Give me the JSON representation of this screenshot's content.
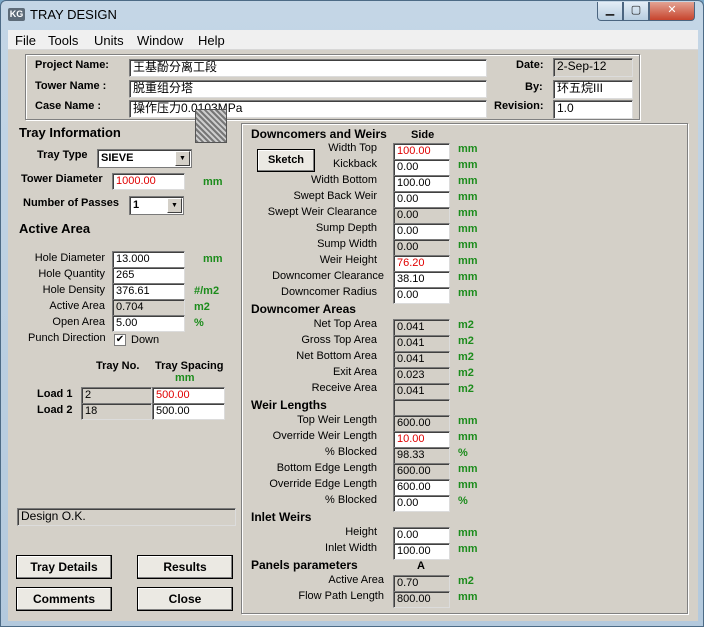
{
  "window": {
    "title": "TRAY DESIGN",
    "icon_text": "KG",
    "min_glyph": "▁",
    "max_glyph": "▢",
    "close_glyph": "✕"
  },
  "menu": [
    "File",
    "Tools",
    "Units",
    "Window",
    "Help"
  ],
  "header": {
    "project_label": "Project Name:",
    "project_value": "王基酚分离工段",
    "tower_label": "Tower Name :",
    "tower_value": "脱重组分塔",
    "case_label": "Case Name :",
    "case_value": "操作压力0.0103MPa",
    "date_label": "Date:",
    "date_value": "2-Sep-12",
    "by_label": "By:",
    "by_value": "环五烷III",
    "revision_label": "Revision:",
    "revision_value": "1.0"
  },
  "tray_info": {
    "heading": "Tray Information",
    "type_label": "Tray Type",
    "type_value": "SIEVE",
    "diameter_label": "Tower Diameter",
    "diameter_value": "1000.00",
    "diameter_unit": "mm",
    "passes_label": "Number of Passes",
    "passes_value": "1"
  },
  "active_area": {
    "heading": "Active Area",
    "rows": [
      {
        "label": "Hole Diameter",
        "value": "13.000",
        "unit": "mm",
        "readonly": false
      },
      {
        "label": "Hole Quantity",
        "value": "265",
        "unit": "",
        "readonly": false
      },
      {
        "label": "Hole Density",
        "value": "376.61",
        "unit": "#/m2",
        "readonly": false
      },
      {
        "label": "Active Area",
        "value": "0.704",
        "unit": "m2",
        "readonly": true
      },
      {
        "label": "Open Area",
        "value": "5.00",
        "unit": "%",
        "readonly": false
      }
    ],
    "punch_label": "Punch Direction",
    "punch_checked": "✔",
    "punch_value": "Down"
  },
  "loads": {
    "tray_no_header": "Tray No.",
    "spacing_header": "Tray Spacing",
    "spacing_unit": "mm",
    "rows": [
      {
        "label": "Load 1",
        "tray_no": "2",
        "spacing": "500.00"
      },
      {
        "label": "Load 2",
        "tray_no": "18",
        "spacing": "500.00"
      }
    ]
  },
  "status": "Design O.K.",
  "buttons": {
    "tray_details": "Tray Details",
    "results": "Results",
    "comments": "Comments",
    "close": "Close",
    "sketch": "Sketch"
  },
  "downcomers": {
    "heading": "Downcomers and Weirs",
    "side_header": "Side",
    "rows": [
      {
        "label": "Width Top",
        "value": "100.00",
        "unit": "mm"
      },
      {
        "label": "Kickback",
        "value": "0.00",
        "unit": "mm"
      },
      {
        "label": "Width Bottom",
        "value": "100.00",
        "unit": "mm"
      },
      {
        "label": "Swept Back Weir",
        "value": "0.00",
        "unit": "mm"
      },
      {
        "label": "Swept Weir Clearance",
        "value": "0.00",
        "unit": "mm"
      },
      {
        "label": "Sump Depth",
        "value": "0.00",
        "unit": "mm"
      },
      {
        "label": "Sump Width",
        "value": "0.00",
        "unit": "mm"
      },
      {
        "label": "Weir Height",
        "value": "76.20",
        "unit": "mm"
      },
      {
        "label": "Downcomer Clearance",
        "value": "38.10",
        "unit": "mm"
      },
      {
        "label": "Downcomer Radius",
        "value": "0.00",
        "unit": "mm"
      }
    ]
  },
  "downcomer_areas": {
    "heading": "Downcomer Areas",
    "rows": [
      {
        "label": "Net Top Area",
        "value": "0.041",
        "unit": "m2"
      },
      {
        "label": "Gross Top Area",
        "value": "0.041",
        "unit": "m2"
      },
      {
        "label": "Net Bottom Area",
        "value": "0.041",
        "unit": "m2"
      },
      {
        "label": "Exit Area",
        "value": "0.023",
        "unit": "m2"
      },
      {
        "label": "Receive Area",
        "value": "0.041",
        "unit": "m2"
      }
    ]
  },
  "weir_lengths": {
    "heading": "Weir Lengths",
    "rows": [
      {
        "label": "Top Weir Length",
        "value": "600.00",
        "unit": "mm"
      },
      {
        "label": "Override Weir Length",
        "value": "10.00",
        "unit": "mm"
      },
      {
        "label": "% Blocked",
        "value": "98.33",
        "unit": "%"
      },
      {
        "label": "Bottom Edge Length",
        "value": "600.00",
        "unit": "mm"
      },
      {
        "label": "Override Edge Length",
        "value": "600.00",
        "unit": "mm"
      },
      {
        "label": "% Blocked",
        "value": "0.00",
        "unit": "%"
      }
    ]
  },
  "inlet_weirs": {
    "heading": "Inlet Weirs",
    "rows": [
      {
        "label": "Height",
        "value": "0.00",
        "unit": "mm"
      },
      {
        "label": "Inlet Width",
        "value": "100.00",
        "unit": "mm"
      }
    ]
  },
  "panels": {
    "heading": "Panels parameters",
    "col_header": "A",
    "rows": [
      {
        "label": "Active Area",
        "value": "0.70",
        "unit": "m2"
      },
      {
        "label": "Flow Path Length",
        "value": "800.00",
        "unit": "mm"
      }
    ]
  }
}
